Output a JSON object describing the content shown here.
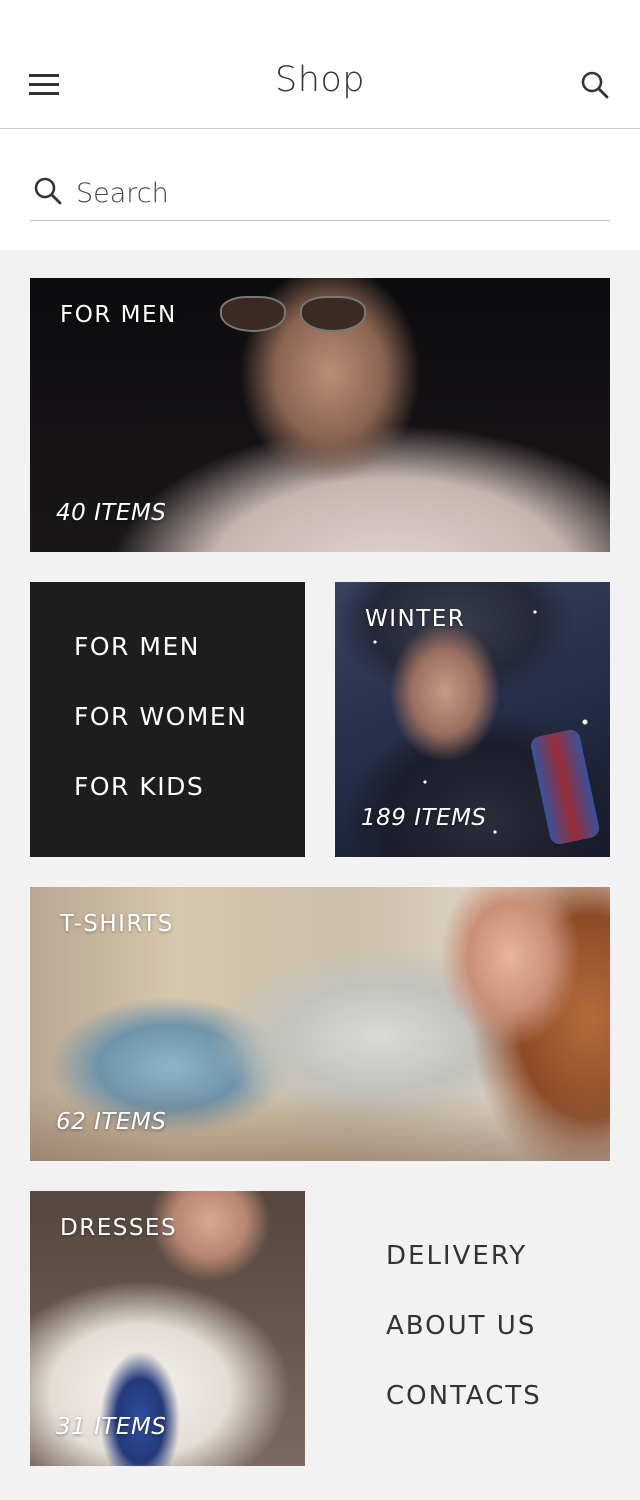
{
  "header": {
    "title": "Shop",
    "menu_icon": "hamburger-menu-icon",
    "search_icon": "search-icon"
  },
  "search": {
    "placeholder": "Search",
    "value": ""
  },
  "tiles": {
    "men": {
      "label": "FOR MEN",
      "count": "40 ITEMS"
    },
    "winter": {
      "label": "WINTER",
      "count": "189 ITEMS"
    },
    "tshirts": {
      "label": "T-SHIRTS",
      "count": "62 ITEMS"
    },
    "dresses": {
      "label": "DRESSES",
      "count": "31 ITEMS"
    }
  },
  "category_menu": {
    "items": [
      "FOR MEN",
      "FOR WOMEN",
      "FOR KIDS"
    ]
  },
  "footer_links": {
    "items": [
      "DELIVERY",
      "ABOUT US",
      "CONTACTS"
    ]
  },
  "colors": {
    "menu_box_bg": "#1d1d1d",
    "page_bg": "#f2f2f2",
    "text": "#333333"
  }
}
